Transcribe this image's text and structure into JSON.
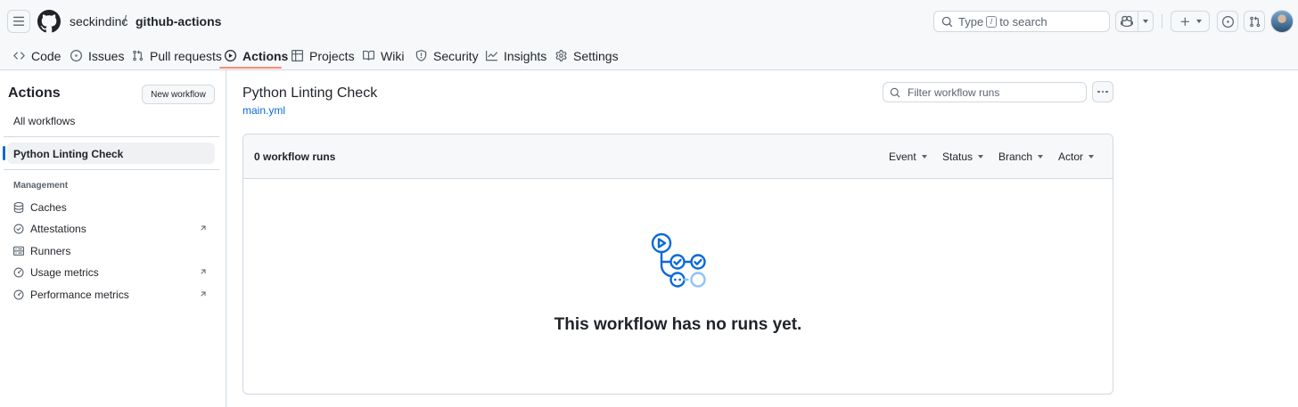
{
  "header": {
    "owner": "seckindinc",
    "separator": "/",
    "repo": "github-actions",
    "search_prefix": "Type",
    "search_key": "/",
    "search_suffix": "to search"
  },
  "tabs": [
    {
      "label": "Code",
      "icon": "code-icon",
      "active": false
    },
    {
      "label": "Issues",
      "icon": "issue-opened-icon",
      "active": false
    },
    {
      "label": "Pull requests",
      "icon": "git-pull-request-icon",
      "active": false
    },
    {
      "label": "Actions",
      "icon": "play-icon",
      "active": true
    },
    {
      "label": "Projects",
      "icon": "table-icon",
      "active": false
    },
    {
      "label": "Wiki",
      "icon": "book-icon",
      "active": false
    },
    {
      "label": "Security",
      "icon": "shield-icon",
      "active": false
    },
    {
      "label": "Insights",
      "icon": "graph-icon",
      "active": false
    },
    {
      "label": "Settings",
      "icon": "gear-icon",
      "active": false
    }
  ],
  "sidebar": {
    "title": "Actions",
    "new_workflow_label": "New workflow",
    "all_workflows_label": "All workflows",
    "workflows": [
      {
        "label": "Python Linting Check",
        "selected": true
      }
    ],
    "management_label": "Management",
    "management_items": [
      {
        "label": "Caches",
        "icon": "database-icon",
        "external": false
      },
      {
        "label": "Attestations",
        "icon": "verified-icon",
        "external": true
      },
      {
        "label": "Runners",
        "icon": "server-icon",
        "external": false
      },
      {
        "label": "Usage metrics",
        "icon": "meter-icon",
        "external": true
      },
      {
        "label": "Performance metrics",
        "icon": "meter-icon",
        "external": true
      }
    ]
  },
  "main": {
    "title": "Python Linting Check",
    "file": "main.yml",
    "filter_placeholder": "Filter workflow runs",
    "runs_count_label": "0 workflow runs",
    "filters": [
      "Event",
      "Status",
      "Branch",
      "Actor"
    ],
    "empty_message": "This workflow has no runs yet."
  },
  "colors": {
    "accent": "#0969da",
    "active_tab_underline": "#fd8c73",
    "border": "#d1d9e0"
  }
}
